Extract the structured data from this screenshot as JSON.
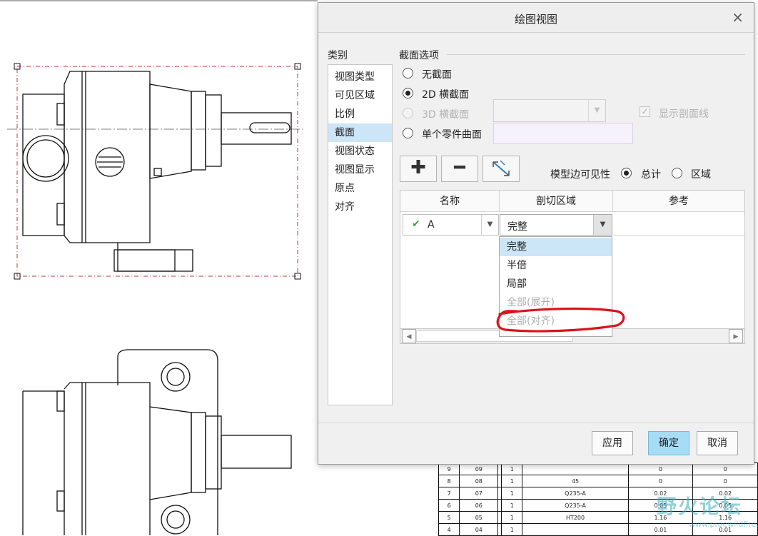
{
  "dialog": {
    "title": "绘图视图",
    "close_glyph": "×",
    "categories_label": "类别",
    "categories": [
      "视图类型",
      "可见区域",
      "比例",
      "截面",
      "视图状态",
      "视图显示",
      "原点",
      "对齐"
    ],
    "active_category": "截面",
    "section_options": {
      "title": "截面选项",
      "no_section": "无截面",
      "section_2d": "2D 横截面",
      "section_3d": "3D 横截面",
      "single_part_surface": "单个零件曲面",
      "show_hatch": "显示剖面线",
      "selected": "2D 横截面"
    },
    "toolbar": {
      "add_glyph": "✚",
      "remove_glyph": "━"
    },
    "edge_visibility": {
      "label": "模型边可见性",
      "total": "总计",
      "area": "区域",
      "selected": "总计"
    },
    "table": {
      "headers": [
        "名称",
        "剖切区域",
        "参考"
      ],
      "row": {
        "name": "A",
        "check_glyph": "✔",
        "zone": "完整"
      },
      "zone_options": [
        "完整",
        "半倍",
        "局部",
        "全部(展开)",
        "全部(对齐)"
      ],
      "zone_options_disabled": [
        "全部(展开)",
        "全部(对齐)"
      ],
      "selected_zone": "完整"
    },
    "buttons": {
      "apply": "应用",
      "ok": "确定",
      "cancel": "取消"
    },
    "highlight_color": "#cde6f7",
    "accent_color": "#a6dcf5",
    "annotation_color": "#d9141b"
  },
  "bom": {
    "rows": [
      [
        "9",
        "09",
        "",
        "1",
        "",
        "0",
        "0"
      ],
      [
        "8",
        "08",
        "",
        "1",
        "45",
        "0",
        "0"
      ],
      [
        "7",
        "07",
        "",
        "1",
        "Q235-A",
        "0.02",
        "0.02"
      ],
      [
        "6",
        "06",
        "",
        "1",
        "Q235-A",
        "0.05",
        "0.05"
      ],
      [
        "5",
        "05",
        "",
        "1",
        "HT200",
        "1.16",
        "1.16"
      ],
      [
        "4",
        "04",
        "",
        "1",
        "",
        "0.01",
        "0.01"
      ]
    ]
  },
  "watermark": {
    "text": "野火论坛",
    "url": "www.proewildfire.cn"
  }
}
